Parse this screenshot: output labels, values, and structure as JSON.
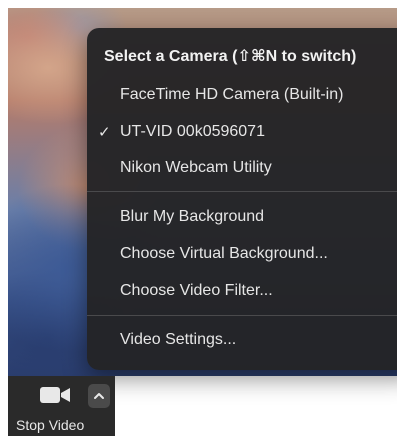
{
  "camera_menu": {
    "header": "Select a Camera (⇧⌘N to switch)",
    "cameras": [
      {
        "label": "FaceTime HD Camera (Built-in)",
        "selected": false
      },
      {
        "label": "UT-VID 00k0596071",
        "selected": true
      },
      {
        "label": "Nikon Webcam Utility",
        "selected": false
      }
    ],
    "checkmark": "✓",
    "background_options": [
      {
        "label": "Blur My Background"
      },
      {
        "label": "Choose Virtual Background..."
      },
      {
        "label": "Choose Video Filter..."
      }
    ],
    "settings": {
      "label": "Video Settings..."
    }
  },
  "toolbar": {
    "stop_video_label": "Stop Video",
    "camera_icon": "video-camera-icon",
    "caret_icon": "chevron-up-icon"
  },
  "colors": {
    "menu_background": "#242426",
    "menu_text": "#e6e6e6",
    "toolbar_background": "#2a2a2a"
  }
}
